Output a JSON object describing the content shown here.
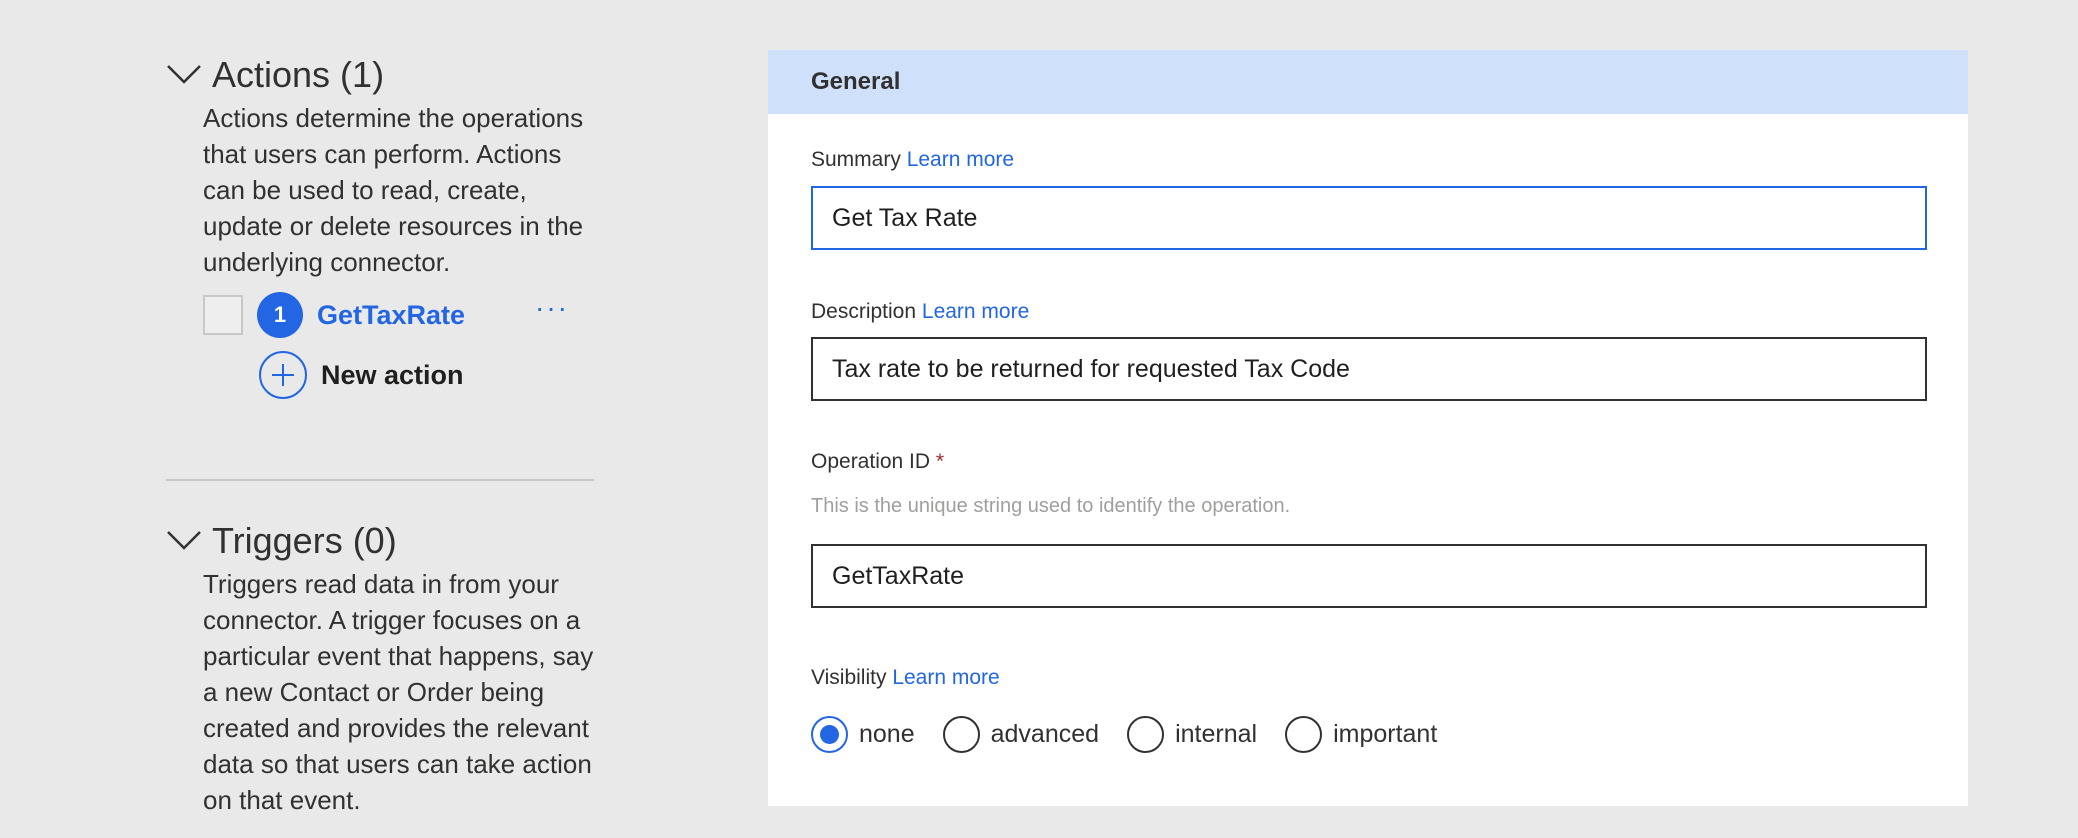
{
  "actions_section": {
    "title": "Actions (1)",
    "description": "Actions determine the operations that users can perform. Actions can be used to read, create, update or delete resources in the underlying connector.",
    "items": [
      {
        "step": "1",
        "name": "GetTaxRate",
        "more": "···"
      }
    ],
    "new_action_label": "New action"
  },
  "triggers_section": {
    "title": "Triggers (0)",
    "description": "Triggers read data in from your connector. A trigger focuses on a particular event that happens, say a new Contact or Order being created and provides the relevant data so that users can take action on that event."
  },
  "general": {
    "header": "General",
    "summary": {
      "label": "Summary",
      "link": "Learn more",
      "value": "Get Tax Rate"
    },
    "description": {
      "label": "Description",
      "link": "Learn more",
      "value": "Tax rate to be returned for requested Tax Code"
    },
    "operation_id": {
      "label": "Operation ID",
      "required": "*",
      "hint": "This is the unique string used to identify the operation.",
      "value": "GetTaxRate"
    },
    "visibility": {
      "label": "Visibility",
      "link": "Learn more",
      "options": [
        "none",
        "advanced",
        "internal",
        "important"
      ],
      "selected": "none"
    }
  },
  "colors": {
    "accent": "#2266e3",
    "header_bg": "#cfe0fa",
    "page_bg": "#e9e9e9",
    "required": "#a4262c"
  },
  "icons": [
    "chevron-down-icon",
    "plus-icon",
    "more-icon"
  ]
}
